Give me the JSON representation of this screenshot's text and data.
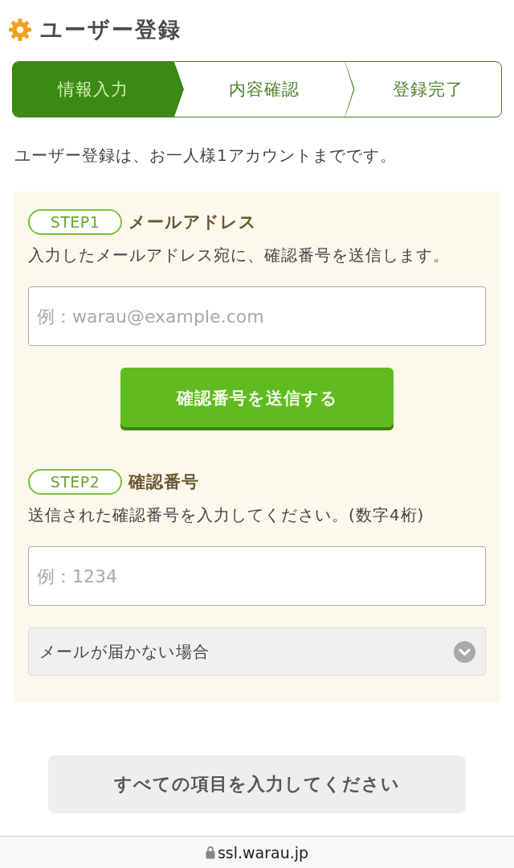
{
  "page_title": "ユーザー登録",
  "steps": [
    {
      "label": "情報入力",
      "selected": true
    },
    {
      "label": "内容確認",
      "selected": false
    },
    {
      "label": "登録完了",
      "selected": false
    }
  ],
  "notice": "ユーザー登録は、お一人様1アカウントまでです。",
  "form": {
    "sections": [
      {
        "badge": "STEP1",
        "title": "メールアドレス",
        "description": "入力したメールアドレス宛に、確認番号を送信します。",
        "field": {
          "placeholder": "例：warau@example.com"
        },
        "button": {
          "label": "確認番号を送信する"
        }
      },
      {
        "badge": "STEP2",
        "title": "確認番号",
        "description": "送信された確認番号を入力してください。(数字4桁)",
        "field": {
          "placeholder": "例：1234"
        },
        "disclosure": {
          "label": "メールが届かない場合",
          "expanded": false
        }
      }
    ]
  },
  "submit_button": {
    "label": "すべての項目を入力してください",
    "disabled": true
  },
  "address_bar": {
    "url": "ssl.warau.jp"
  }
}
